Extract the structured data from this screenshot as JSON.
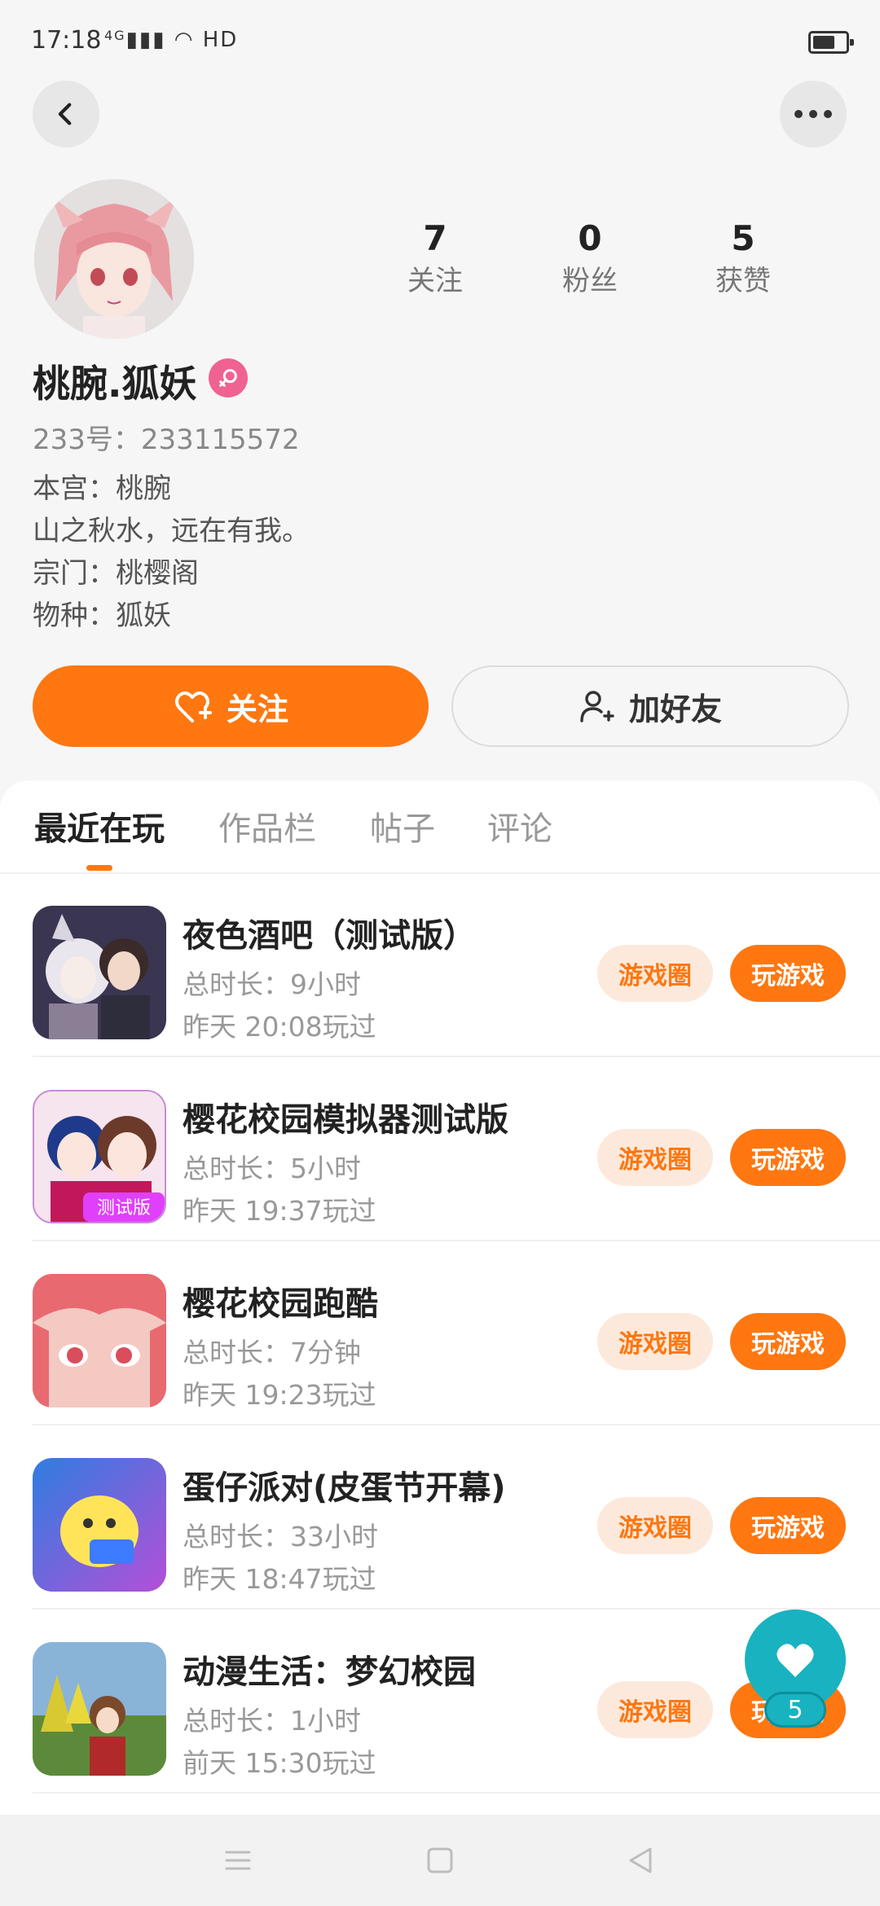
{
  "status_bar": {
    "time": "17:18",
    "network": "4G",
    "hd": "HD"
  },
  "profile": {
    "name": "桃腕.狐妖",
    "uid": "233号：233115572",
    "gender_icon": "female-icon",
    "bio": [
      "本宫：桃腕",
      "山之秋水，远在有我。",
      "宗门：桃樱阁",
      "物种：狐妖"
    ],
    "stats": [
      {
        "num": "7",
        "label": "关注"
      },
      {
        "num": "0",
        "label": "粉丝"
      },
      {
        "num": "5",
        "label": "获赞"
      }
    ]
  },
  "actions": {
    "follow": "关注",
    "add_friend": "加好友"
  },
  "tabs": [
    "最近在玩",
    "作品栏",
    "帖子",
    "评论"
  ],
  "games": [
    {
      "title": "夜色酒吧（测试版）",
      "duration": "总时长：9小时",
      "last_played": "昨天 20:08玩过"
    },
    {
      "title": "樱花校园模拟器测试版",
      "duration": "总时长：5小时",
      "last_played": "昨天 19:37玩过"
    },
    {
      "title": "樱花校园跑酷",
      "duration": "总时长：7分钟",
      "last_played": "昨天 19:23玩过"
    },
    {
      "title": "蛋仔派对(皮蛋节开幕)",
      "duration": "总时长：33小时",
      "last_played": "昨天 18:47玩过"
    },
    {
      "title": "动漫生活：梦幻校园",
      "duration": "总时长：1小时",
      "last_played": "前天 15:30玩过"
    }
  ],
  "row_buttons": {
    "circle": "游戏圈",
    "play": "玩游戏"
  },
  "fab": {
    "count": "5"
  },
  "colors": {
    "accent": "#ff7710",
    "accent_light": "#fde9dc",
    "fab": "#18b2c0",
    "female": "#f06292"
  }
}
